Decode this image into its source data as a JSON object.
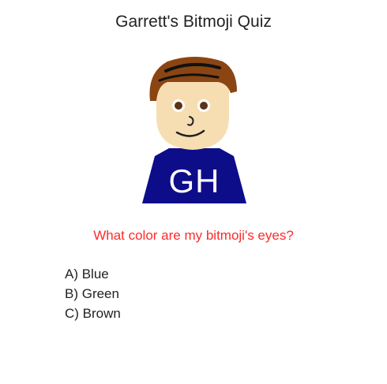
{
  "quiz": {
    "title": "Garrett's Bitmoji Quiz",
    "question": "What color are my bitmoji's eyes?",
    "question_color": "#ff2a2a",
    "answers": [
      {
        "label": "A) Blue"
      },
      {
        "label": "B) Green"
      },
      {
        "label": "C) Brown"
      }
    ]
  },
  "avatar": {
    "shirt_text": "GH",
    "hair_color": "#8b4513",
    "skin_color": "#f7deb2",
    "shirt_color": "#0d0d8a",
    "eye_color": "#5a3418"
  }
}
